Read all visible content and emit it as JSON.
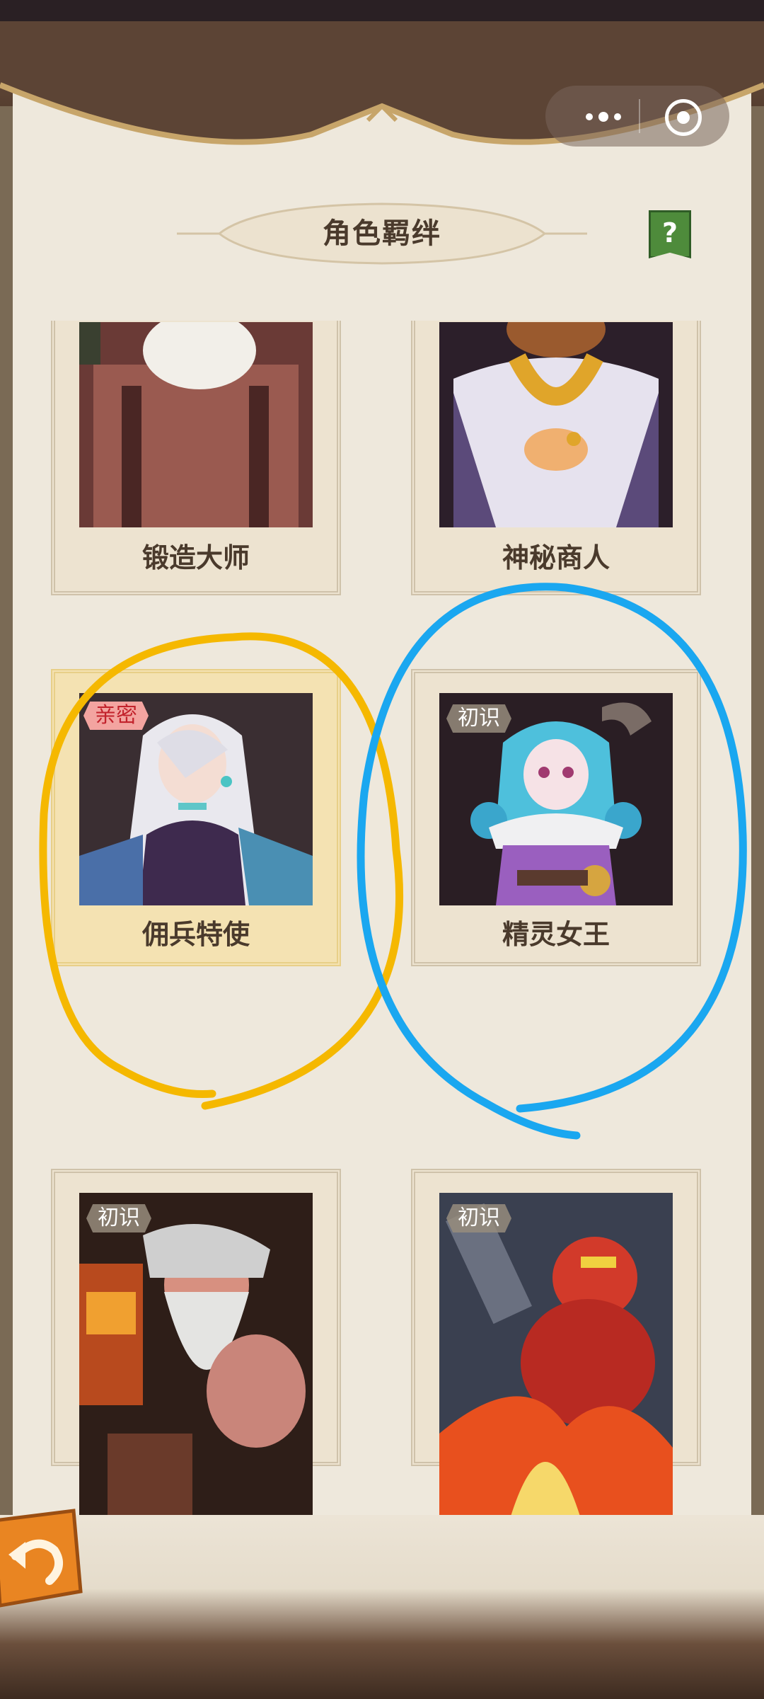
{
  "header": {
    "title": "角色羁绊",
    "help_label": "?"
  },
  "capsule": {
    "more_icon": "more-dots-icon",
    "close_icon": "target-circle-icon"
  },
  "cards": [
    {
      "name": "锻造大师",
      "badge": ""
    },
    {
      "name": "神秘商人",
      "badge": ""
    },
    {
      "name": "佣兵特使",
      "badge": "亲密"
    },
    {
      "name": "精灵女王",
      "badge": "初识"
    },
    {
      "name": "",
      "badge": "初识"
    },
    {
      "name": "",
      "badge": "初识"
    }
  ],
  "annotations": {
    "yellow_color": "#f5b800",
    "blue_color": "#1aa7f0"
  },
  "footer": {
    "back_icon": "return-arrow-icon"
  }
}
